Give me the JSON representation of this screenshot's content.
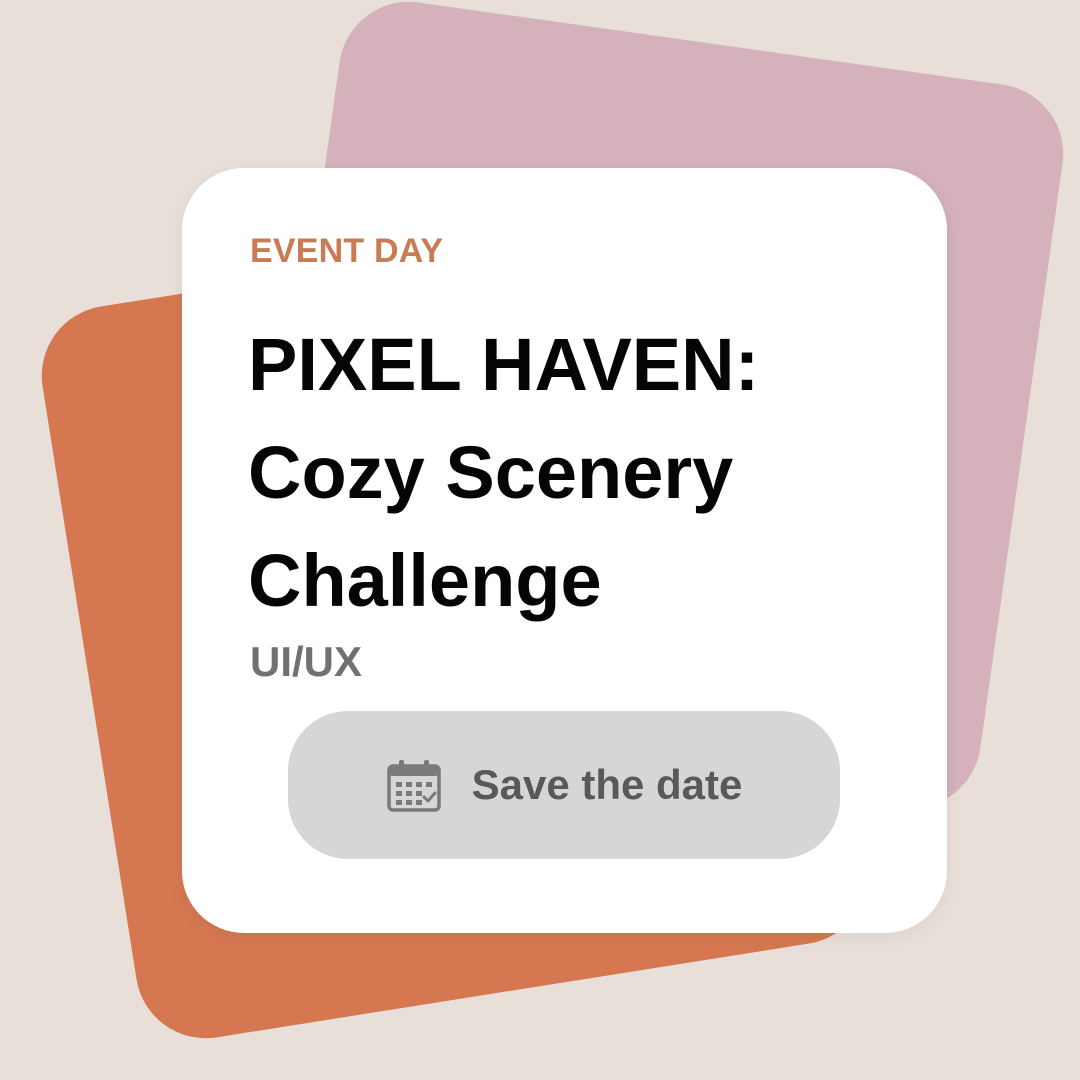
{
  "card": {
    "eyebrow": "EVENT DAY",
    "title_lines": [
      "PIXEL HAVEN:",
      "Cozy Scenery",
      "Challenge"
    ],
    "category": "UI/UX",
    "cta": {
      "label": "Save the date",
      "icon": "calendar-icon"
    }
  },
  "colors": {
    "background": "#e8e0d8",
    "back_card_pink": "#d4b1bb",
    "back_card_orange": "#d57852",
    "card": "#ffffff",
    "eyebrow": "#c97b55",
    "title": "#050505",
    "category": "#717171",
    "button_bg": "#d6d6d6",
    "button_text": "#595959"
  }
}
